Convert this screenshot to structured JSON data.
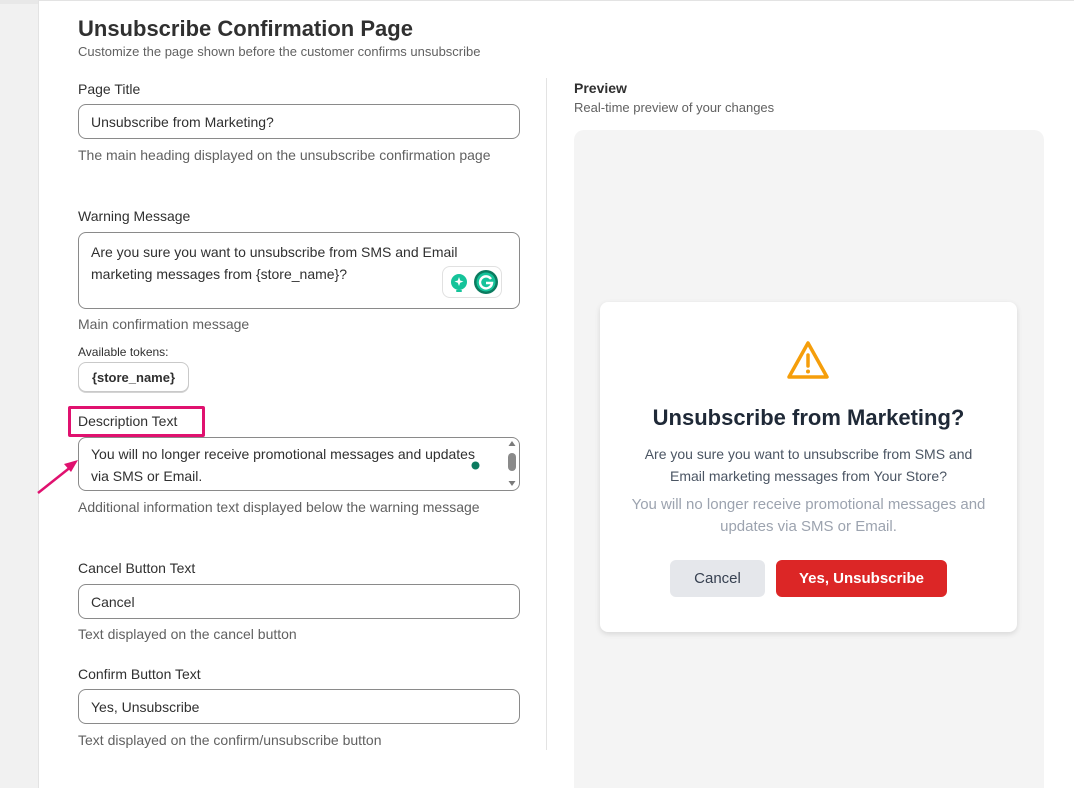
{
  "header": {
    "title": "Unsubscribe Confirmation Page",
    "subtitle": "Customize the page shown before the customer confirms unsubscribe"
  },
  "form": {
    "page_title": {
      "label": "Page Title",
      "value": "Unsubscribe from Marketing?",
      "help": "The main heading displayed on the unsubscribe confirmation page"
    },
    "warning_message": {
      "label": "Warning Message",
      "value": "Are you sure you want to unsubscribe from SMS and Email marketing messages from {store_name}?",
      "help": "Main confirmation message",
      "tokens_label": "Available tokens:",
      "tokens": [
        "{store_name}"
      ]
    },
    "description_text": {
      "label": "Description Text",
      "value": "You will no longer receive promotional messages and updates via SMS or Email.",
      "help": "Additional information text displayed below the warning message"
    },
    "cancel_button_text": {
      "label": "Cancel Button Text",
      "value": "Cancel",
      "help": "Text displayed on the cancel button"
    },
    "confirm_button_text": {
      "label": "Confirm Button Text",
      "value": "Yes, Unsubscribe",
      "help": "Text displayed on the confirm/unsubscribe button"
    }
  },
  "preview": {
    "title": "Preview",
    "subtitle": "Real-time preview of your changes",
    "modal": {
      "icon": "warning-triangle-icon",
      "title": "Unsubscribe from Marketing?",
      "warning": "Are you sure you want to unsubscribe from SMS and Email marketing messages from Your Store?",
      "description": "You will no longer receive promotional messages and updates via SMS or Email.",
      "cancel_label": "Cancel",
      "confirm_label": "Yes, Unsubscribe"
    }
  },
  "colors": {
    "confirm_button": "#dc2626",
    "cancel_button": "#e5e7eb",
    "warning_icon": "#f59e0b",
    "annotation": "#e0116f"
  }
}
